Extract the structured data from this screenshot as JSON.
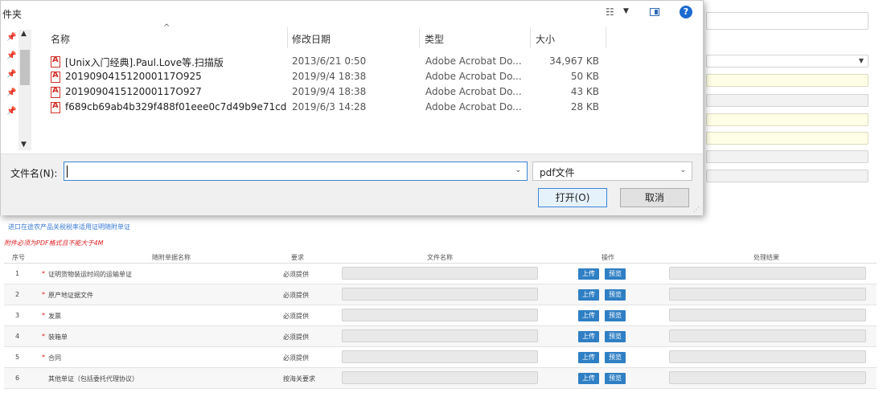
{
  "dialog": {
    "title": "件夹",
    "filename_label": "文件名(N):",
    "filename_value": "",
    "filetype_value": "pdf文件",
    "open_label": "打开(O)",
    "cancel_label": "取消",
    "columns": {
      "name": "名称",
      "date": "修改日期",
      "type": "类型",
      "size": "大小"
    },
    "files": [
      {
        "name": "[Unix入门经典].Paul.Love等.扫描版",
        "date": "2013/6/21 0:50",
        "type": "Adobe Acrobat Do...",
        "size": "34,967 KB"
      },
      {
        "name": "201909041512000117O925",
        "date": "2019/9/4 18:38",
        "type": "Adobe Acrobat Do...",
        "size": "50 KB"
      },
      {
        "name": "201909041512000117O927",
        "date": "2019/9/4 18:38",
        "type": "Adobe Acrobat Do...",
        "size": "43 KB"
      },
      {
        "name": "f689cb69ab4b329f488f01eee0c7d49b9e71cd",
        "date": "2019/6/3 14:28",
        "type": "Adobe Acrobat Do...",
        "size": "28 KB"
      }
    ]
  },
  "page": {
    "link_text": "进口在途农产品关税税率适用证明随附单证",
    "warning": "附件必须为PDF格式且不能大于4M",
    "table": {
      "headers": {
        "index": "序号",
        "doc_name": "随附单据名称",
        "requirement": "要求",
        "file_name": "文件名称",
        "action": "操作",
        "result": "处理结果"
      },
      "upload_label": "上传",
      "preview_label": "预览",
      "rows": [
        {
          "index": "1",
          "required": true,
          "name": "证明货物装运时间的运输单证",
          "requirement": "必须提供"
        },
        {
          "index": "2",
          "required": true,
          "name": "原产地证据文件",
          "requirement": "必须提供"
        },
        {
          "index": "3",
          "required": true,
          "name": "发票",
          "requirement": "必须提供"
        },
        {
          "index": "4",
          "required": true,
          "name": "装箱单",
          "requirement": "必须提供"
        },
        {
          "index": "5",
          "required": true,
          "name": "合同",
          "requirement": "必须提供"
        },
        {
          "index": "6",
          "required": false,
          "name": "其他单证（包括委托代理协议）",
          "requirement": "按海关要求"
        }
      ]
    }
  }
}
